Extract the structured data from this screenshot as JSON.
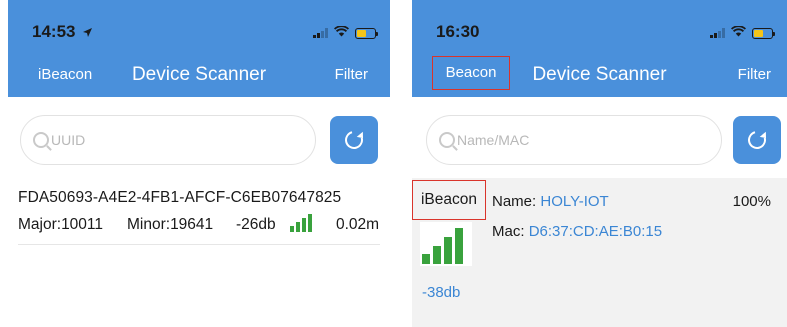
{
  "screens": [
    {
      "status": {
        "time": "14:53",
        "location_icon": "location-arrow-icon"
      },
      "nav": {
        "left": "iBeacon",
        "title": "Device Scanner",
        "right": "Filter"
      },
      "search": {
        "placeholder": "UUID"
      },
      "devices": [
        {
          "uuid": "FDA50693-A4E2-4FB1-AFCF-C6EB07647825",
          "major": "Major:10011",
          "minor": "Minor:19641",
          "rssi": "-26db",
          "signal_bars": 4,
          "distance": "0.02m"
        }
      ]
    },
    {
      "status": {
        "time": "16:30"
      },
      "nav": {
        "left": "Beacon",
        "title": "Device Scanner",
        "right": "Filter"
      },
      "search": {
        "placeholder": "Name/MAC"
      },
      "devices": [
        {
          "type": "iBeacon",
          "name_label": "Name:",
          "name": "HOLY-IOT",
          "mac_label": "Mac:",
          "mac": "D6:37:CD:AE:B0:15",
          "battery": "100%",
          "rssi": "-38db",
          "signal_bars": 4
        }
      ]
    }
  ],
  "colors": {
    "header": "#4a90db",
    "signal_green": "#39a23d",
    "highlight_box": "#d9342b",
    "value_blue": "#3b86d4",
    "battery_yellow": "#f5c518"
  }
}
